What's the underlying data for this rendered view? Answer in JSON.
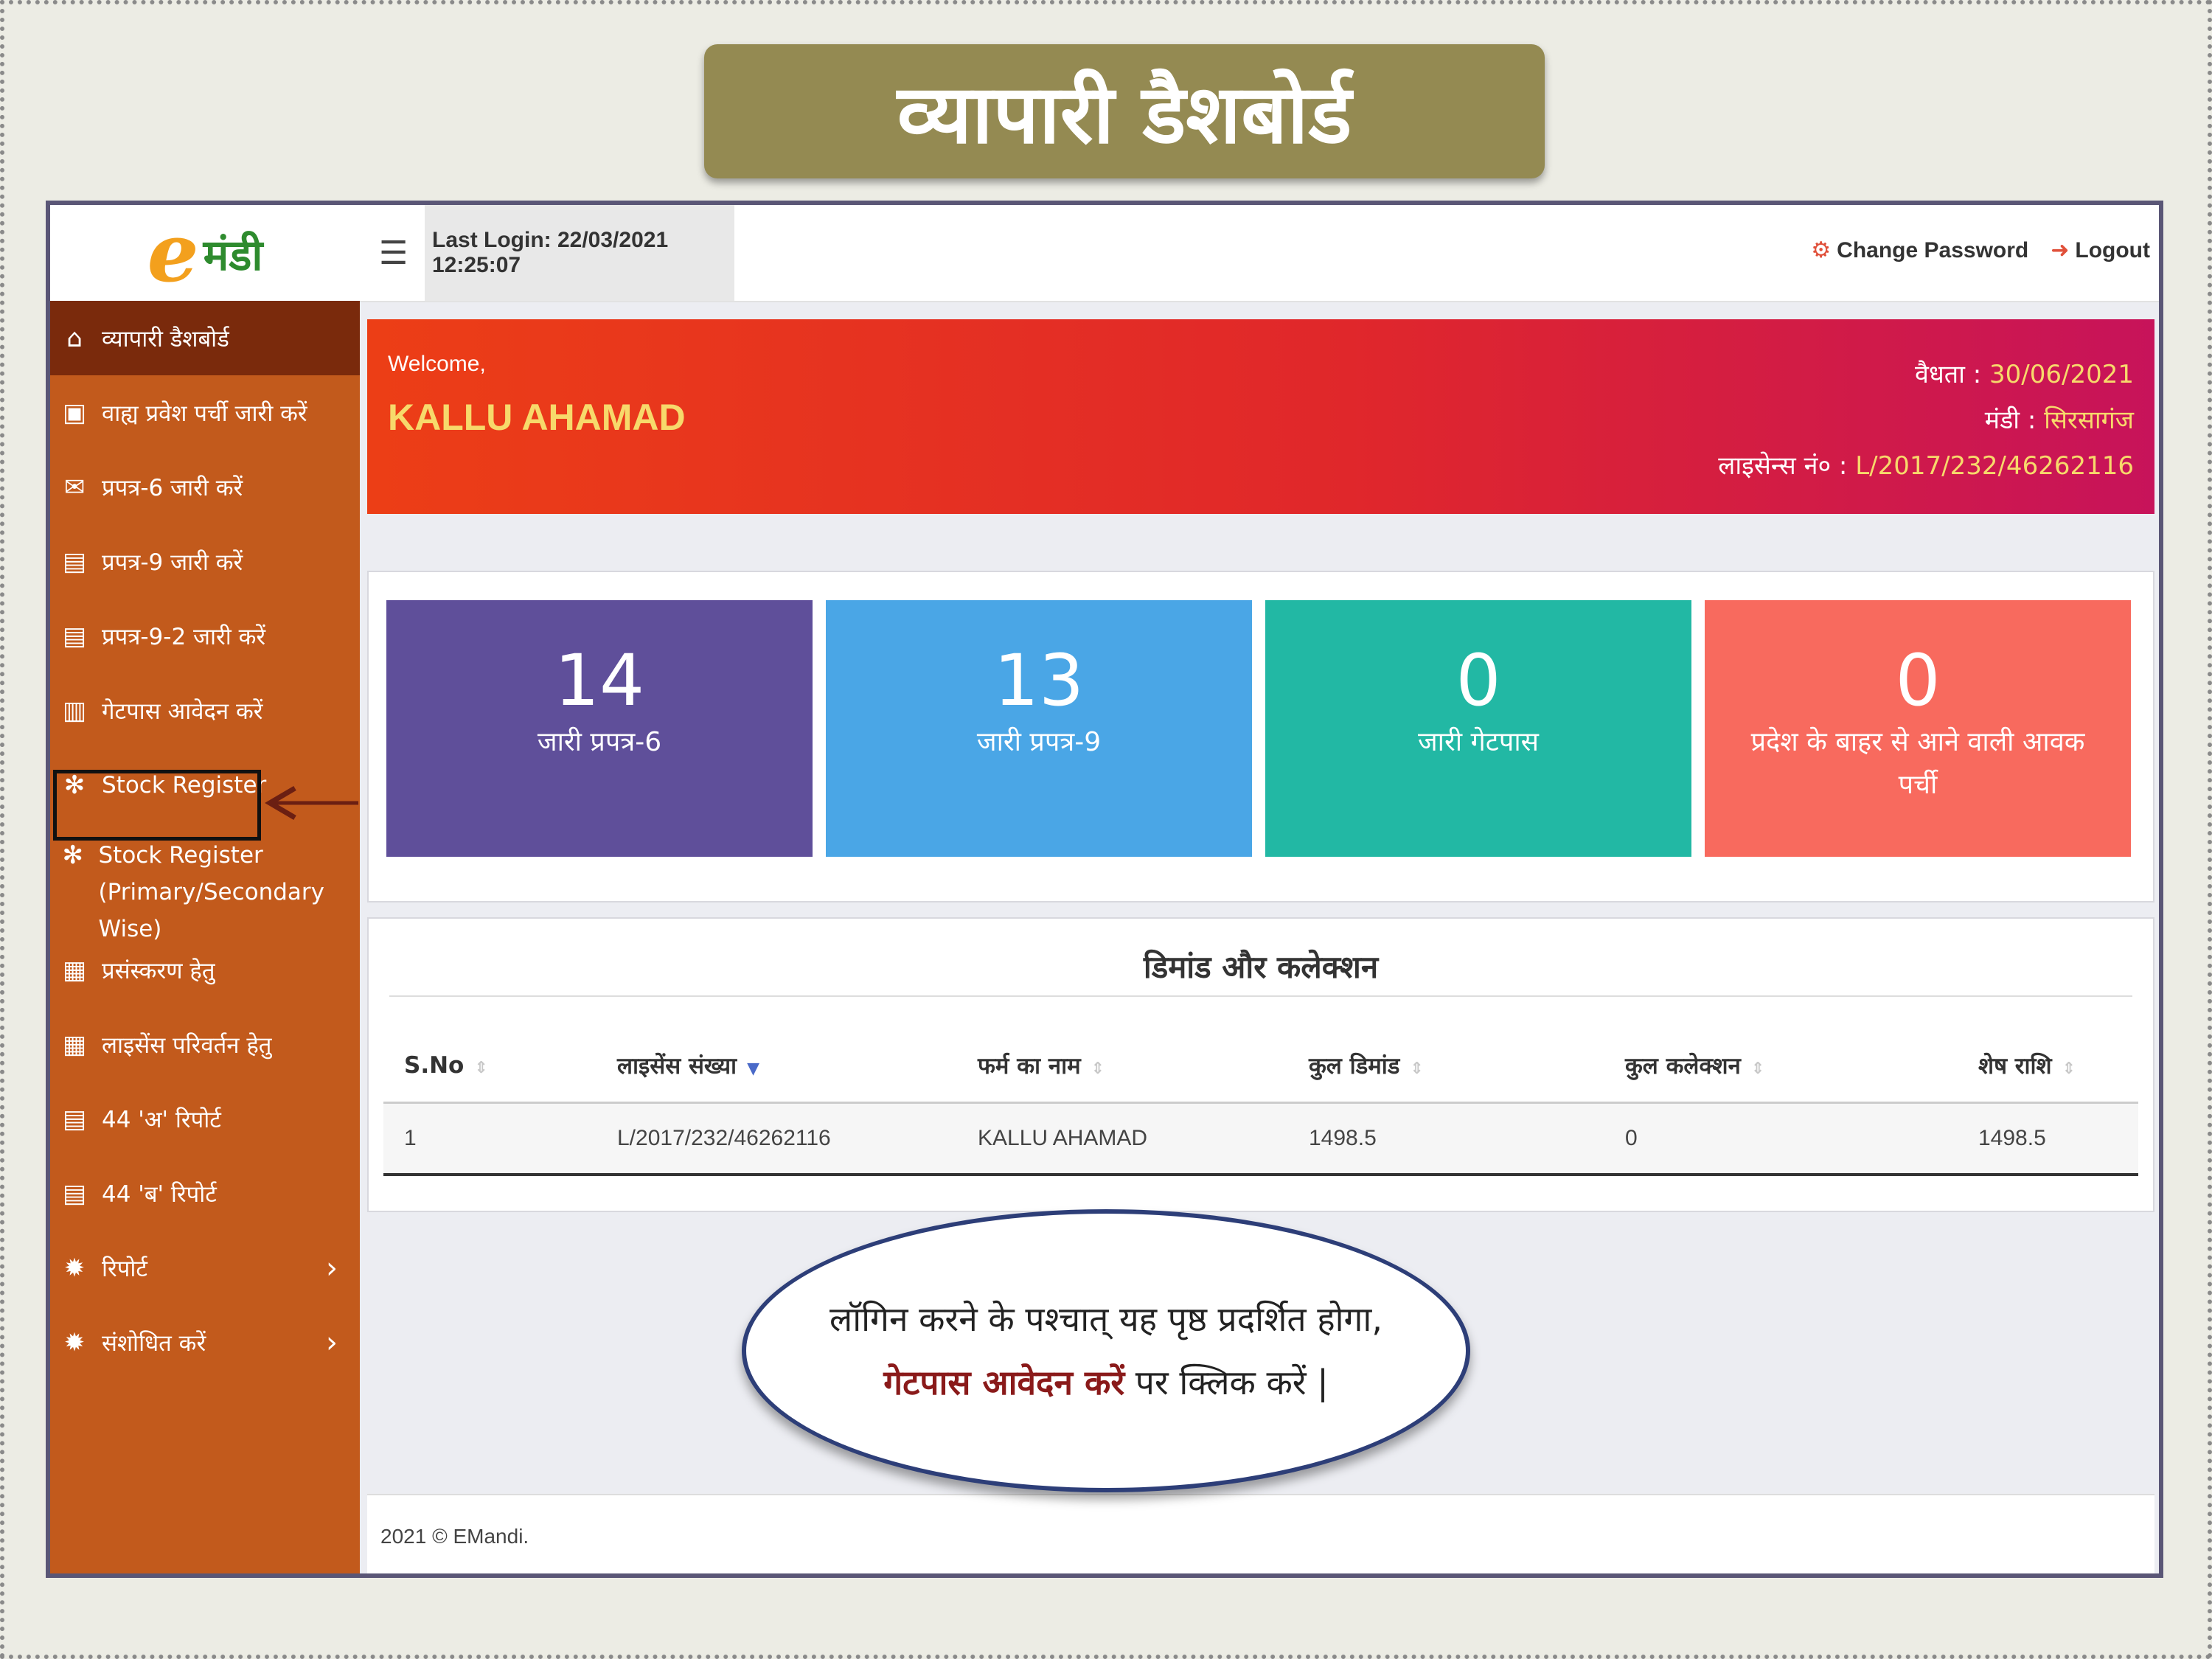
{
  "banner": {
    "title": "व्यापारी डैशबोर्ड"
  },
  "header": {
    "logo_letter": "e",
    "logo_text": "मंडी",
    "menu_icon": "hamburger-icon",
    "last_login": "Last Login: 22/03/2021 12:25:07",
    "change_password": "Change Password",
    "logout": "Logout"
  },
  "sidebar": {
    "items": [
      {
        "label": "व्यापारी डैशबोर्ड",
        "icon": "home-icon"
      },
      {
        "label": "वाह्य प्रवेश पर्ची जारी करें",
        "icon": "entry-slip-icon"
      },
      {
        "label": "प्रपत्र-6 जारी करें",
        "icon": "envelope-icon"
      },
      {
        "label": "प्रपत्र-9 जारी करें",
        "icon": "document-icon"
      },
      {
        "label": "प्रपत्र-9-2 जारी करें",
        "icon": "document-icon"
      },
      {
        "label": "गेटपास आवेदन करें",
        "icon": "bar-chart-icon"
      },
      {
        "label": "Stock Register",
        "icon": "snowflake-icon"
      },
      {
        "label": "Stock Register",
        "label2": "(Primary/Secondary Wise)",
        "icon": "snowflake-icon"
      },
      {
        "label": "प्रसंस्करण हेतु",
        "icon": "grid-icon"
      },
      {
        "label": "लाइसेंस परिवर्तन हेतु",
        "icon": "grid-icon"
      },
      {
        "label": "44 'अ' रिपोर्ट",
        "icon": "document-icon"
      },
      {
        "label": "44 'ब' रिपोर्ट",
        "icon": "document-icon"
      },
      {
        "label": "रिपोर्ट",
        "icon": "gear-icon"
      },
      {
        "label": "संशोधित करें",
        "icon": "gear-icon"
      }
    ]
  },
  "welcome": {
    "greeting": "Welcome,",
    "name": "KALLU AHAMAD",
    "validity_label": "वैधता : ",
    "validity_value": "30/06/2021",
    "mandi_label": "मंडी : ",
    "mandi_value": "सिरसागंज",
    "license_label": "लाइसेन्स नं० : ",
    "license_value": "L/2017/232/46262116"
  },
  "stats": [
    {
      "value": "14",
      "label": "जारी प्रपत्र-6",
      "color": "#5f4f9a"
    },
    {
      "value": "13",
      "label": "जारी प्रपत्र-9",
      "color": "#4aa6e6"
    },
    {
      "value": "0",
      "label": "जारी गेटपास",
      "color": "#22b8a4"
    },
    {
      "value": "0",
      "label": "प्रदेश के बाहर से आने वाली आवक पर्ची",
      "color": "#f86a5e"
    }
  ],
  "demand": {
    "title": "डिमांड और कलेक्शन",
    "columns": [
      "S.No",
      "लाइसेंस संख्या",
      "फर्म का नाम",
      "कुल डिमांड",
      "कुल कलेक्शन",
      "शेष राशि"
    ],
    "rows": [
      [
        "1",
        "L/2017/232/46262116",
        "KALLU AHAMAD",
        "1498.5",
        "0",
        "1498.5"
      ]
    ]
  },
  "footer": {
    "text": "2021 © EMandi."
  },
  "callout": {
    "line1": "लॉगिन करने के पश्चात् यह पृष्ठ प्रदर्शित होगा,",
    "highlight": "गेटपास आवेदन करें",
    "rest": " पर क्लिक करें |"
  }
}
